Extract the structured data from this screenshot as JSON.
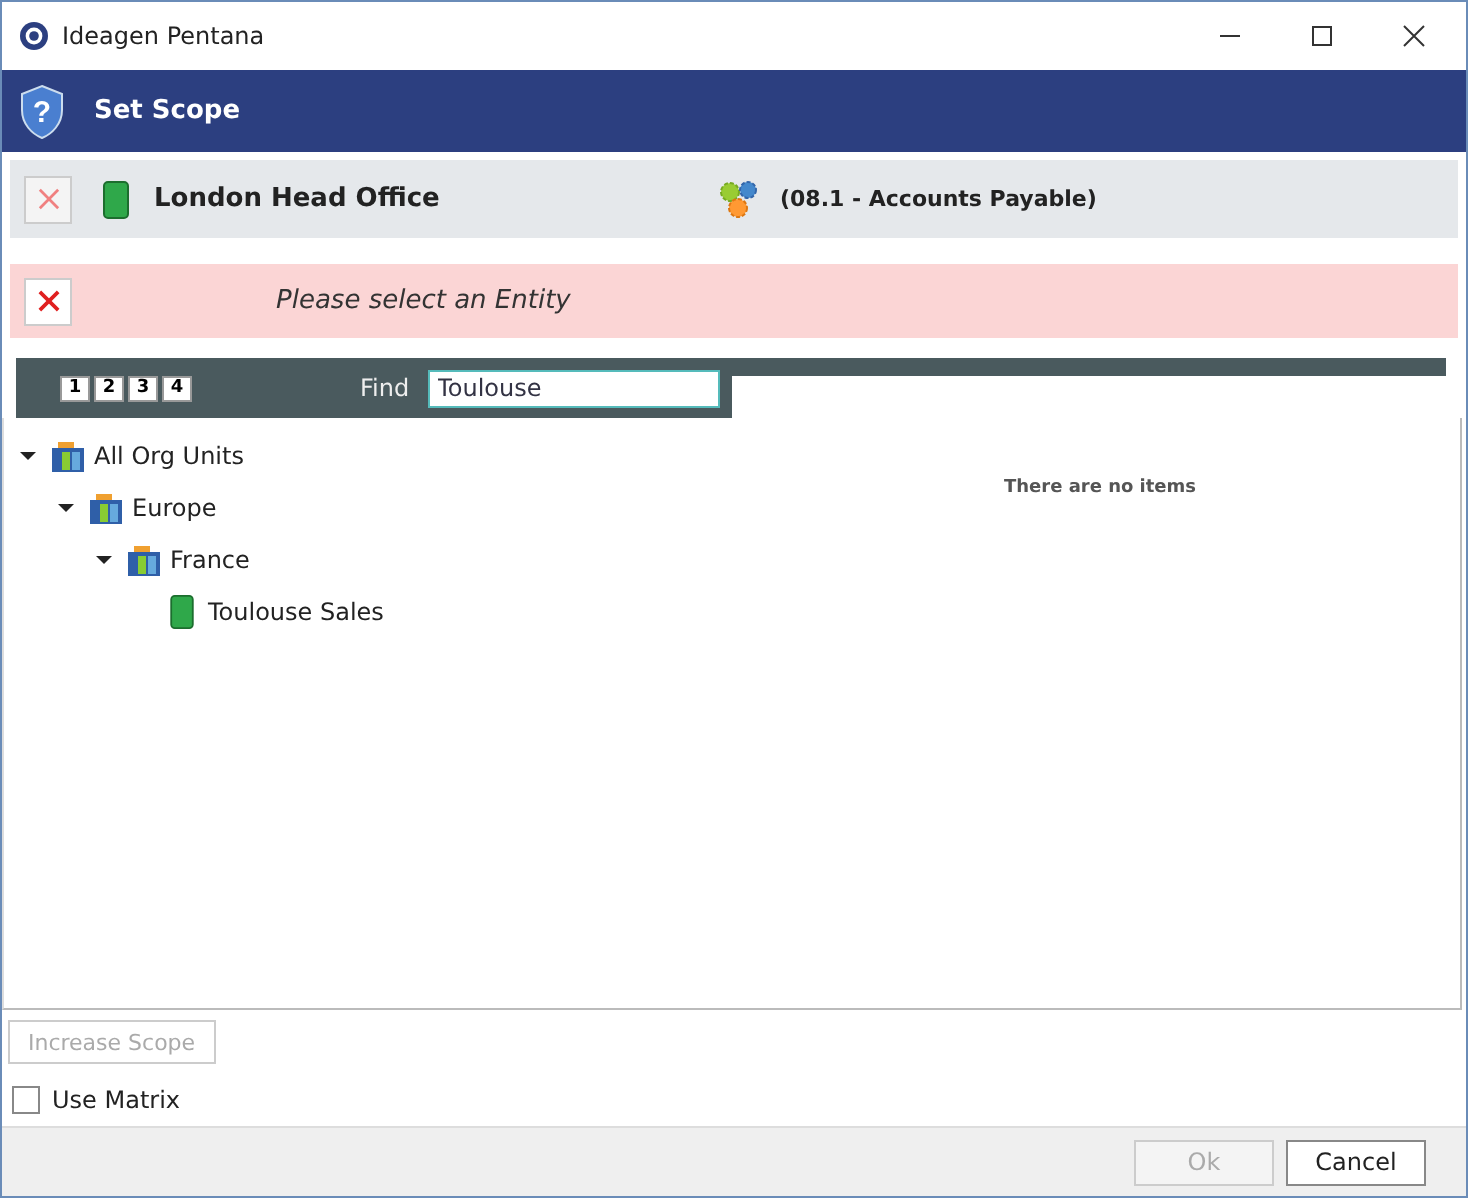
{
  "window": {
    "title": "Ideagen Pentana"
  },
  "header": {
    "icon": "?",
    "title": "Set Scope"
  },
  "scope": {
    "entity": "London Head Office",
    "process": "(08.1 - Accounts Payable)"
  },
  "error": {
    "message": "Please select an Entity"
  },
  "levels": [
    "1",
    "2",
    "3",
    "4"
  ],
  "find": {
    "label": "Find",
    "value": "Toulouse"
  },
  "tree": [
    {
      "label": "All Org Units",
      "kind": "group",
      "expanded": true,
      "children": [
        {
          "label": "Europe",
          "kind": "group",
          "expanded": true,
          "children": [
            {
              "label": "France",
              "kind": "group",
              "expanded": true,
              "children": [
                {
                  "label": "Toulouse Sales",
                  "kind": "entity"
                }
              ]
            }
          ]
        }
      ]
    }
  ],
  "empty_message": "There are no items",
  "increase_scope": {
    "label": "Increase Scope",
    "disabled": true
  },
  "use_matrix": {
    "label": "Use Matrix",
    "checked": false
  },
  "buttons": [
    {
      "label": "Ok",
      "disabled": true
    },
    {
      "label": "Cancel",
      "disabled": false
    }
  ]
}
